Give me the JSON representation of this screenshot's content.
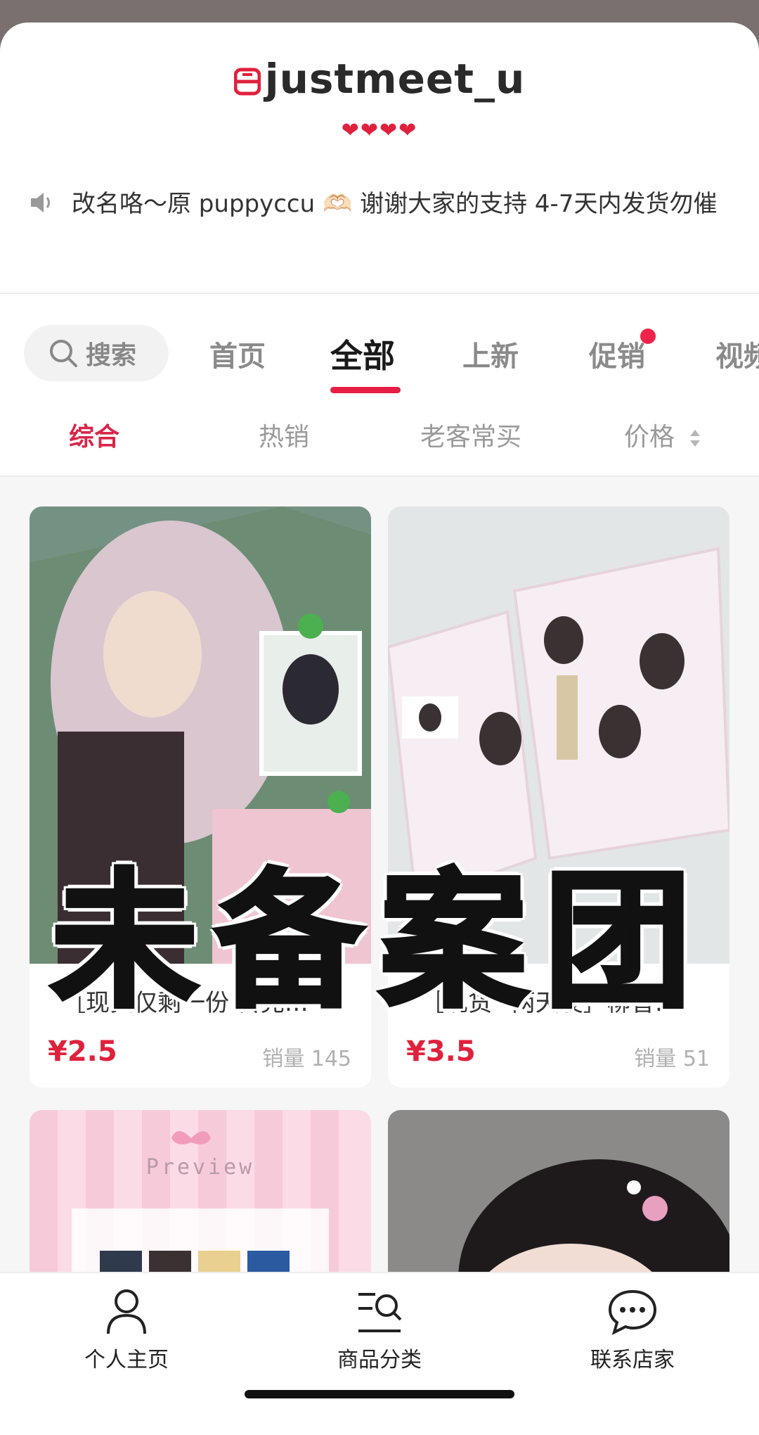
{
  "shop": {
    "name": "justmeet_u",
    "hearts": "❤❤❤❤",
    "notice": "改名咯～原 puppyccu 🫶🏻 谢谢大家的支持 4-7天内发货勿催"
  },
  "tabs": {
    "search_label": "搜索",
    "items": [
      "首页",
      "全部",
      "上新",
      "促销",
      "视频"
    ],
    "active": "全部"
  },
  "subtabs": {
    "items": [
      "综合",
      "热销",
      "老客常买",
      "价格"
    ],
    "active": "综合"
  },
  "products": [
    {
      "title": "［现货仅剩一份 售完…",
      "price": "¥2.5",
      "sales": "销量 145"
    },
    {
      "title": "［现货* 两天发］柳智…",
      "price": "¥3.5",
      "sales": "销量 51"
    },
    {
      "title": "",
      "price": "",
      "sales": "",
      "image_text": "Preview"
    },
    {
      "title": "",
      "price": "",
      "sales": ""
    }
  ],
  "overlay": "未备案团",
  "bottom_nav": [
    {
      "label": "个人主页",
      "icon": "person-icon"
    },
    {
      "label": "商品分类",
      "icon": "category-search-icon"
    },
    {
      "label": "联系店家",
      "icon": "chat-bubble-icon"
    }
  ],
  "colors": {
    "accent": "#e61e44",
    "price": "#e0213d"
  }
}
